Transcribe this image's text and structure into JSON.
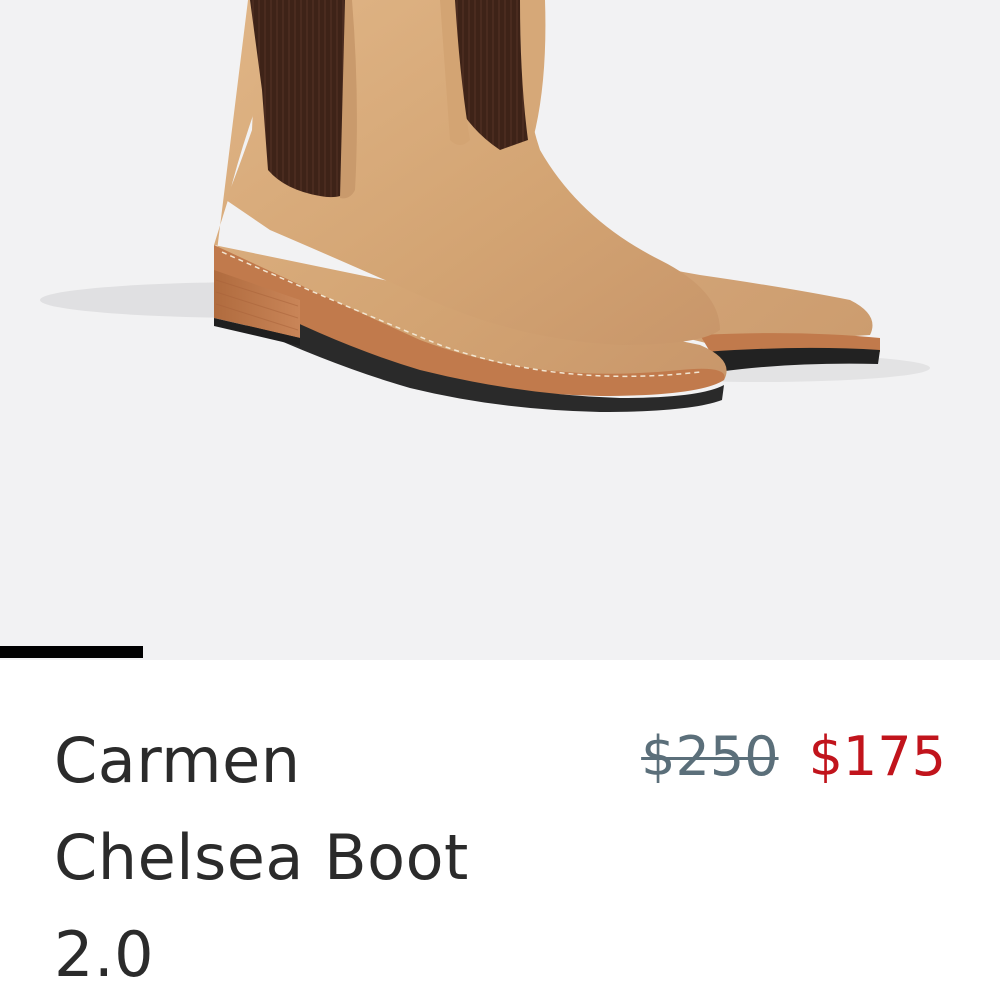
{
  "product": {
    "title_lines": [
      "Carmen",
      "Chelsea Boot",
      "2.0"
    ],
    "price_original": "$250",
    "price_sale": "$175"
  },
  "gallery": {
    "image_icon": "chelsea-boot-photo",
    "progress_fraction": 0.143
  },
  "colors": {
    "background": "#f2f2f3",
    "sale_price": "#c1141c",
    "original_price": "#5b6f7a",
    "title_text": "#2b2b2b",
    "boot_leather": "#d6a878",
    "boot_elastic": "#3e2318"
  }
}
